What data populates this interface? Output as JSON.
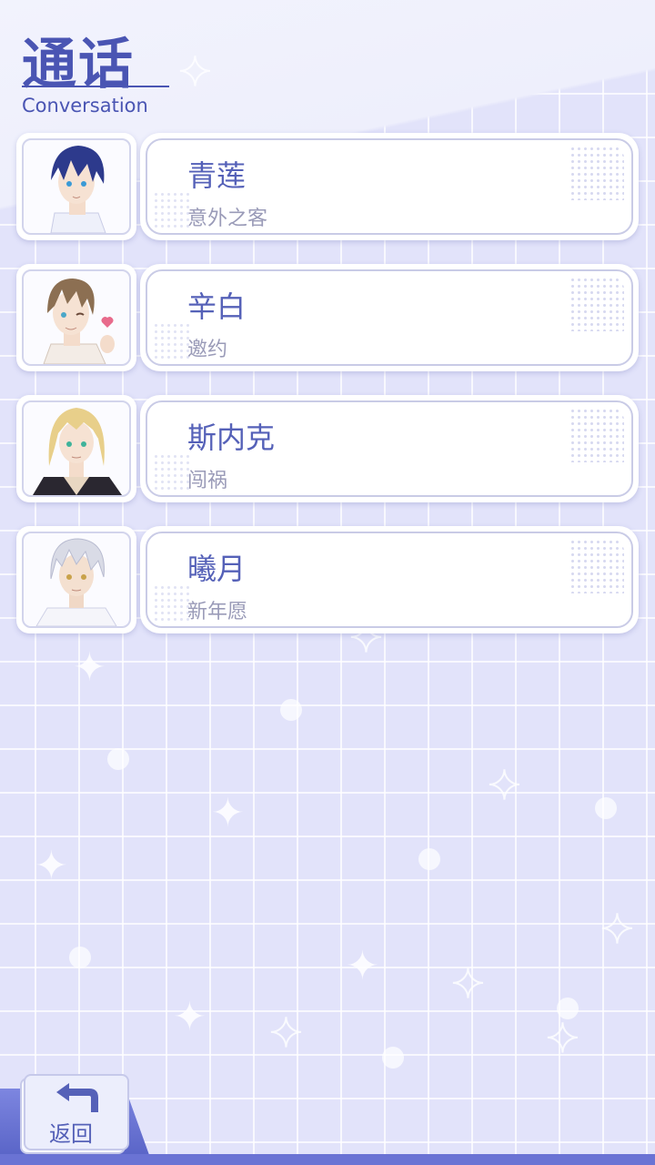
{
  "header": {
    "title": "通话",
    "subtitle": "Conversation"
  },
  "contacts": [
    {
      "name": "青莲",
      "subtitle": "意外之客",
      "avatar": "avatar-navy-hair"
    },
    {
      "name": "辛白",
      "subtitle": "邀约",
      "avatar": "avatar-brown-hair"
    },
    {
      "name": "斯内克",
      "subtitle": "闯祸",
      "avatar": "avatar-blonde-hair"
    },
    {
      "name": "曦月",
      "subtitle": "新年愿",
      "avatar": "avatar-silver-hair"
    }
  ],
  "back_button": {
    "label": "返回",
    "icon": "back-arrow-icon"
  },
  "colors": {
    "accent": "#4a55b3",
    "name_text": "#5561b8",
    "sub_text": "#9a9bb8",
    "background": "#e2e3fa"
  }
}
